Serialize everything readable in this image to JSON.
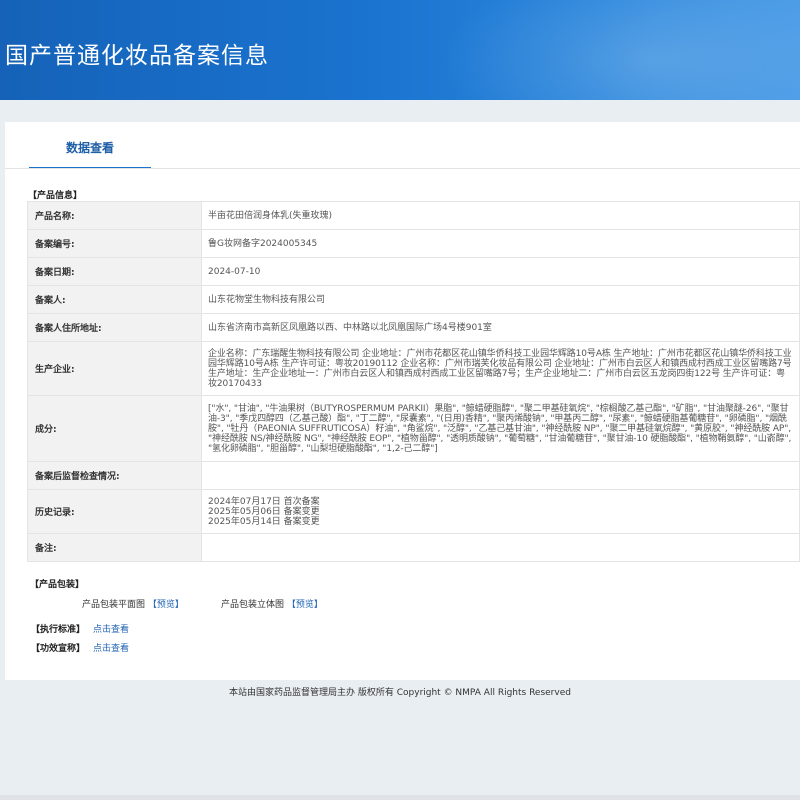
{
  "header": {
    "title": "国产普通化妆品备案信息"
  },
  "tab": {
    "label": "数据查看"
  },
  "product_info": {
    "section_label": "【产品信息】",
    "rows": [
      {
        "label": "产品名称:",
        "value": "半亩花田倍润身体乳(失重玫瑰)"
      },
      {
        "label": "备案编号:",
        "value": "鲁G妆网备字2024005345"
      },
      {
        "label": "备案日期:",
        "value": "2024-07-10"
      },
      {
        "label": "备案人:",
        "value": "山东花物堂生物科技有限公司"
      },
      {
        "label": "备案人住所地址:",
        "value": "山东省济南市高新区凤凰路以西、中林路以北凤凰国际广场4号楼901室"
      },
      {
        "label": "生产企业:",
        "value": "企业名称：广东瑞醒生物科技有限公司 企业地址：广州市花都区花山镇华侨科技工业园华辉路10号A栋 生产地址：广州市花都区花山镇华侨科技工业园华辉路10号A栋 生产许可证：粤妆20190112 企业名称：广州市瑞芙化妆品有限公司 企业地址：广州市白云区人和镇西成村西成工业区留嘴路7号 生产地址：生产企业地址一：广州市白云区人和镇西成村西成工业区留嘴路7号；生产企业地址二：广州市白云区五龙岗四街122号 生产许可证：粤妆20170433"
      },
      {
        "label": "成分:",
        "value": "[\"水\", \"甘油\", \"牛油果树（BUTYROSPERMUM PARKII）果脂\", \"鲸蜡硬脂醇\", \"聚二甲基硅氧烷\", \"棕榈酸乙基己酯\", \"矿脂\", \"甘油聚醚-26\", \"聚甘油-3\", \"季戊四醇四（乙基己酸）酯\", \"丁二醇\", \"尿囊素\", \"(日用)香精\", \"聚丙烯酸钠\", \"甲基丙二醇\", \"尿素\", \"鲸蜡硬脂基葡糖苷\", \"卵磷脂\", \"烟酰胺\", \"牡丹（PAEONIA SUFFRUTICOSA）籽油\", \"角鲨烷\", \"泛醇\", \"乙基己基甘油\", \"神经酰胺 NP\", \"聚二甲基硅氧烷醇\", \"黄原胶\", \"神经酰胺 AP\", \"神经酰胺 NS/神经酰胺 NG\", \"神经酰胺 EOP\", \"植物甾醇\", \"透明质酸钠\", \"葡萄糖\", \"甘油葡糖苷\", \"聚甘油-10 硬脂酸酯\", \"植物鞘氨醇\", \"山嵛醇\", \"氢化卵磷脂\", \"胆甾醇\", \"山梨坦硬脂酸酯\", \"1,2-己二醇\"]"
      },
      {
        "label": "备案后监督检查情况:",
        "value": ""
      },
      {
        "label": "历史记录:",
        "lines": [
          "2024年07月17日 首次备案",
          "2025年05月06日 备案变更",
          "2025年05月14日 备案变更"
        ]
      },
      {
        "label": "备注:",
        "value": ""
      }
    ]
  },
  "packaging": {
    "section_label": "【产品包装】",
    "flat_label": "产品包装平面图",
    "solid_label": "产品包装立体图",
    "bracket_open": "【",
    "bracket_close": "】",
    "preview_link": "预览"
  },
  "standards": {
    "exec_label": "【执行标准】",
    "effect_label": "【功效宣称】",
    "link": "点击查看"
  },
  "footer": {
    "text": "本站由国家药品监督管理局主办 版权所有 Copyright © NMPA All Rights Reserved"
  }
}
